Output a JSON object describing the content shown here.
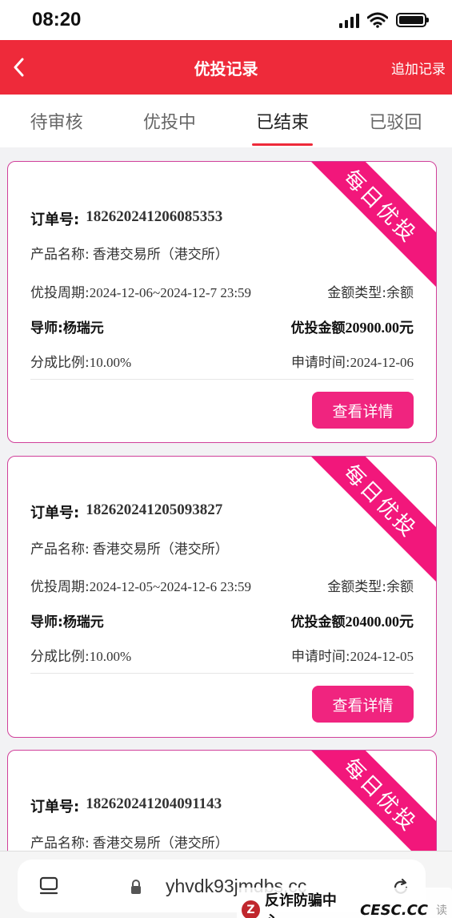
{
  "status_bar": {
    "time": "08:20"
  },
  "nav": {
    "title": "优投记录",
    "right_action": "追加记录"
  },
  "tabs": [
    "待审核",
    "优投中",
    "已结束",
    "已驳回"
  ],
  "active_tab": "已结束",
  "cards": [
    {
      "ribbon": "每日优投",
      "order_label": "订单号:",
      "order_no": "182620241206085353",
      "product_label": "产品名称:",
      "product": "香港交易所（港交所）",
      "period_label": "优投周期:",
      "period": "2024-12-06~2024-12-7 23:59",
      "amount_type_label": "金额类型:",
      "amount_type": "余额",
      "mentor_label": "导师:",
      "mentor": "杨瑞元",
      "amount_label": "优投金额",
      "amount": "20900.00元",
      "ratio_label": "分成比例:",
      "ratio": "10.00%",
      "apply_label": "申请时间:",
      "apply_date": "2024-12-06",
      "button": "查看详情"
    },
    {
      "ribbon": "每日优投",
      "order_label": "订单号:",
      "order_no": "182620241205093827",
      "product_label": "产品名称:",
      "product": "香港交易所（港交所）",
      "period_label": "优投周期:",
      "period": "2024-12-05~2024-12-6 23:59",
      "amount_type_label": "金额类型:",
      "amount_type": "余额",
      "mentor_label": "导师:",
      "mentor": "杨瑞元",
      "amount_label": "优投金额",
      "amount": "20400.00元",
      "ratio_label": "分成比例:",
      "ratio": "10.00%",
      "apply_label": "申请时间:",
      "apply_date": "2024-12-05",
      "button": "查看详情"
    },
    {
      "ribbon": "每日优投",
      "order_label": "订单号:",
      "order_no": "182620241204091143",
      "product_label": "产品名称:",
      "product": "香港交易所（港交所）"
    }
  ],
  "browser": {
    "url": "yhvdk93jmdbs.cc"
  },
  "watermark": {
    "logo": "Z",
    "text": "反诈防骗中心",
    "site": "CESC.CC",
    "read": "读"
  }
}
